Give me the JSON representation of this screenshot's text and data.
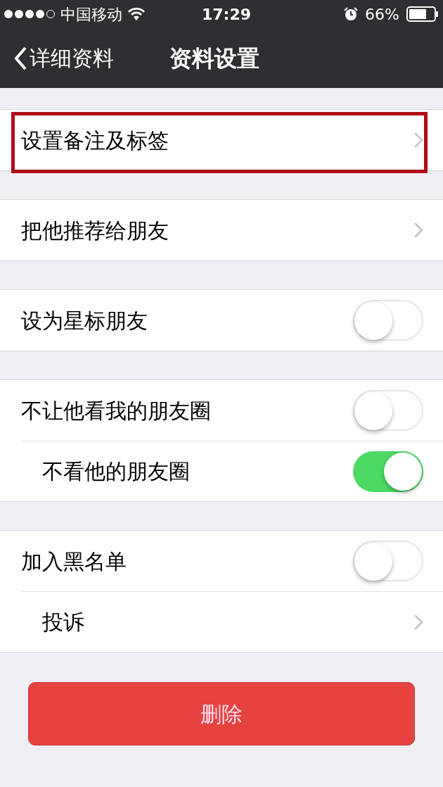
{
  "status_bar": {
    "carrier": "中国移动",
    "time": "17:29",
    "battery": "66%"
  },
  "nav": {
    "back": "详细资料",
    "title": "资料设置"
  },
  "groups": [
    {
      "rows": [
        {
          "kind": "link",
          "label": "设置备注及标签",
          "highlighted": true
        }
      ]
    },
    {
      "rows": [
        {
          "kind": "link",
          "label": "把他推荐给朋友",
          "highlighted": false
        }
      ]
    },
    {
      "rows": [
        {
          "kind": "toggle",
          "label": "设为星标朋友",
          "on": false
        }
      ]
    },
    {
      "rows": [
        {
          "kind": "toggle",
          "label": "不让他看我的朋友圈",
          "on": false
        },
        {
          "kind": "toggle",
          "label": "不看他的朋友圈",
          "on": true
        }
      ]
    },
    {
      "rows": [
        {
          "kind": "toggle",
          "label": "加入黑名单",
          "on": false
        },
        {
          "kind": "link",
          "label": "投诉",
          "highlighted": false
        }
      ]
    }
  ],
  "delete_button": "删除"
}
